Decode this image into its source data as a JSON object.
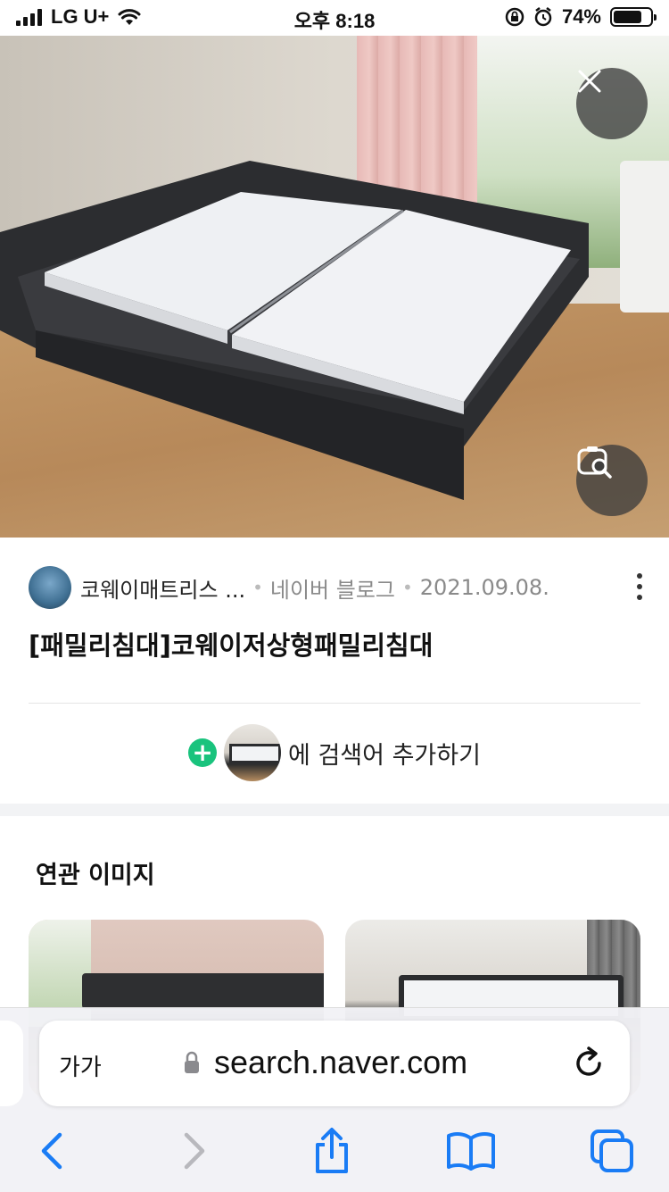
{
  "status_bar": {
    "carrier": "LG U+",
    "time": "오후 8:18",
    "battery_percent": "74%"
  },
  "hero": {
    "description_icons": [
      "close-icon",
      "lens-search-icon"
    ]
  },
  "source": {
    "author": "코웨이매트리스 ...",
    "platform": "네이버 블로그",
    "date": "2021.09.08.",
    "separator": "•"
  },
  "title": "[패밀리침대]코웨이저상형패밀리침대",
  "add_search": {
    "text": "에 검색어 추가하기"
  },
  "related": {
    "heading": "연관 이미지"
  },
  "safari": {
    "text_size_label": "가가",
    "url": "search.naver.com"
  },
  "colors": {
    "accent_green": "#19c37d",
    "ios_blue": "#1a7cf5"
  }
}
